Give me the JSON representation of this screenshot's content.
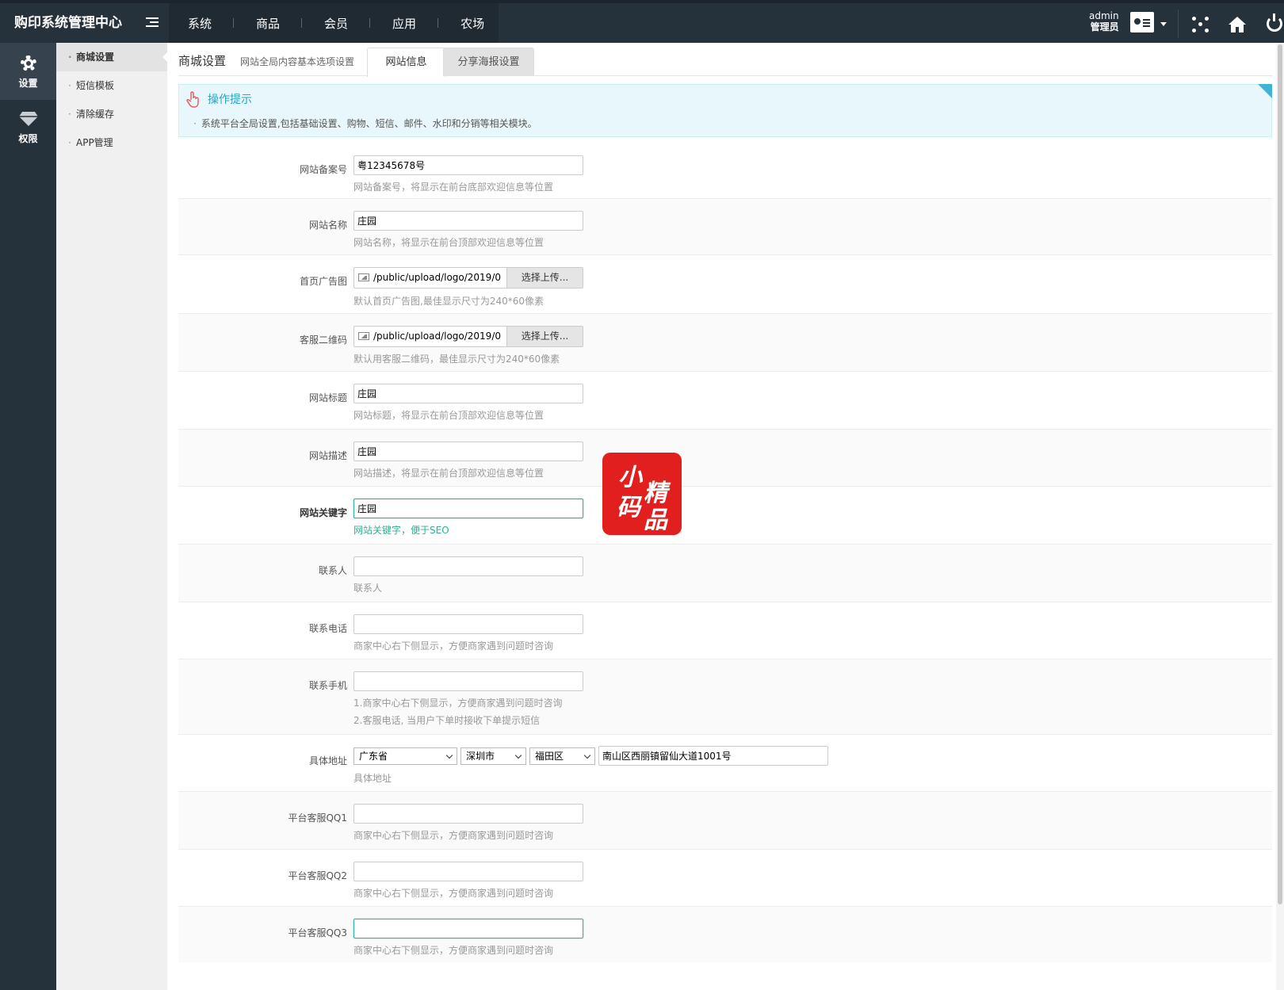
{
  "app": {
    "title": "购印系统管理中心"
  },
  "topnav": {
    "items": [
      "系统",
      "商品",
      "会员",
      "应用",
      "农场"
    ]
  },
  "user": {
    "name": "admin",
    "role": "管理员"
  },
  "iconbar": {
    "items": [
      {
        "label": "设置",
        "icon": "gear-icon",
        "active": true
      },
      {
        "label": "权限",
        "icon": "diamond-icon",
        "active": false
      }
    ]
  },
  "submenu": {
    "items": [
      "商城设置",
      "短信模板",
      "清除缓存",
      "APP管理"
    ]
  },
  "page": {
    "title": "商城设置",
    "subtitle": "网站全局内容基本选项设置",
    "tabs": [
      {
        "label": "网站信息",
        "active": true
      },
      {
        "label": "分享海报设置",
        "active": false
      }
    ]
  },
  "tips": {
    "title": "操作提示",
    "text": "系统平台全局设置,包括基础设置、购物、短信、邮件、水印和分销等相关模块。"
  },
  "form": {
    "icp": {
      "label": "网站备案号",
      "value": "粤12345678号",
      "hint": "网站备案号，将显示在前台底部欢迎信息等位置"
    },
    "site_name": {
      "label": "网站名称",
      "value": "庄园",
      "hint": "网站名称，将显示在前台顶部欢迎信息等位置"
    },
    "home_ad": {
      "label": "首页广告图",
      "value": "/public/upload/logo/2019/0",
      "button": "选择上传...",
      "hint": "默认首页广告图,最佳显示尺寸为240*60像素"
    },
    "service_qr": {
      "label": "客服二维码",
      "value": "/public/upload/logo/2019/0",
      "button": "选择上传...",
      "hint": "默认用客服二维码，最佳显示尺寸为240*60像素"
    },
    "site_title": {
      "label": "网站标题",
      "value": "庄园",
      "hint": "网站标题，将显示在前台顶部欢迎信息等位置"
    },
    "site_desc": {
      "label": "网站描述",
      "value": "庄园",
      "hint": "网站描述，将显示在前台顶部欢迎信息等位置"
    },
    "site_keywords": {
      "label": "网站关键字",
      "value": "庄园",
      "hint": "网站关键字，便于SEO"
    },
    "contact": {
      "label": "联系人",
      "value": "",
      "hint": "联系人"
    },
    "phone": {
      "label": "联系电话",
      "value": "",
      "hint": "商家中心右下侧显示，方便商家遇到问题时咨询"
    },
    "mobile": {
      "label": "联系手机",
      "value": "",
      "hint1": "1.商家中心右下侧显示，方便商家遇到问题时咨询",
      "hint2": "2.客服电话, 当用户下单时接收下单提示短信"
    },
    "address": {
      "label": "具体地址",
      "province": "广东省",
      "city": "深圳市",
      "district": "福田区",
      "detail": "南山区西丽镇留仙大道1001号",
      "hint": "具体地址"
    },
    "qq1": {
      "label": "平台客服QQ1",
      "value": "",
      "hint": "商家中心右下侧显示，方便商家遇到问题时咨询"
    },
    "qq2": {
      "label": "平台客服QQ2",
      "value": "",
      "hint": "商家中心右下侧显示，方便商家遇到问题时咨询"
    },
    "qq3": {
      "label": "平台客服QQ3",
      "value": "",
      "hint": "商家中心右下侧显示，方便商家遇到问题时咨询"
    }
  },
  "watermark": {
    "chars": [
      "小",
      "精",
      "码",
      "品"
    ]
  },
  "colors": {
    "topbar": "#25313b",
    "accent_teal": "#2fb29b",
    "tips_blue": "#2aa2c5",
    "seal_red": "#e21f1f"
  }
}
